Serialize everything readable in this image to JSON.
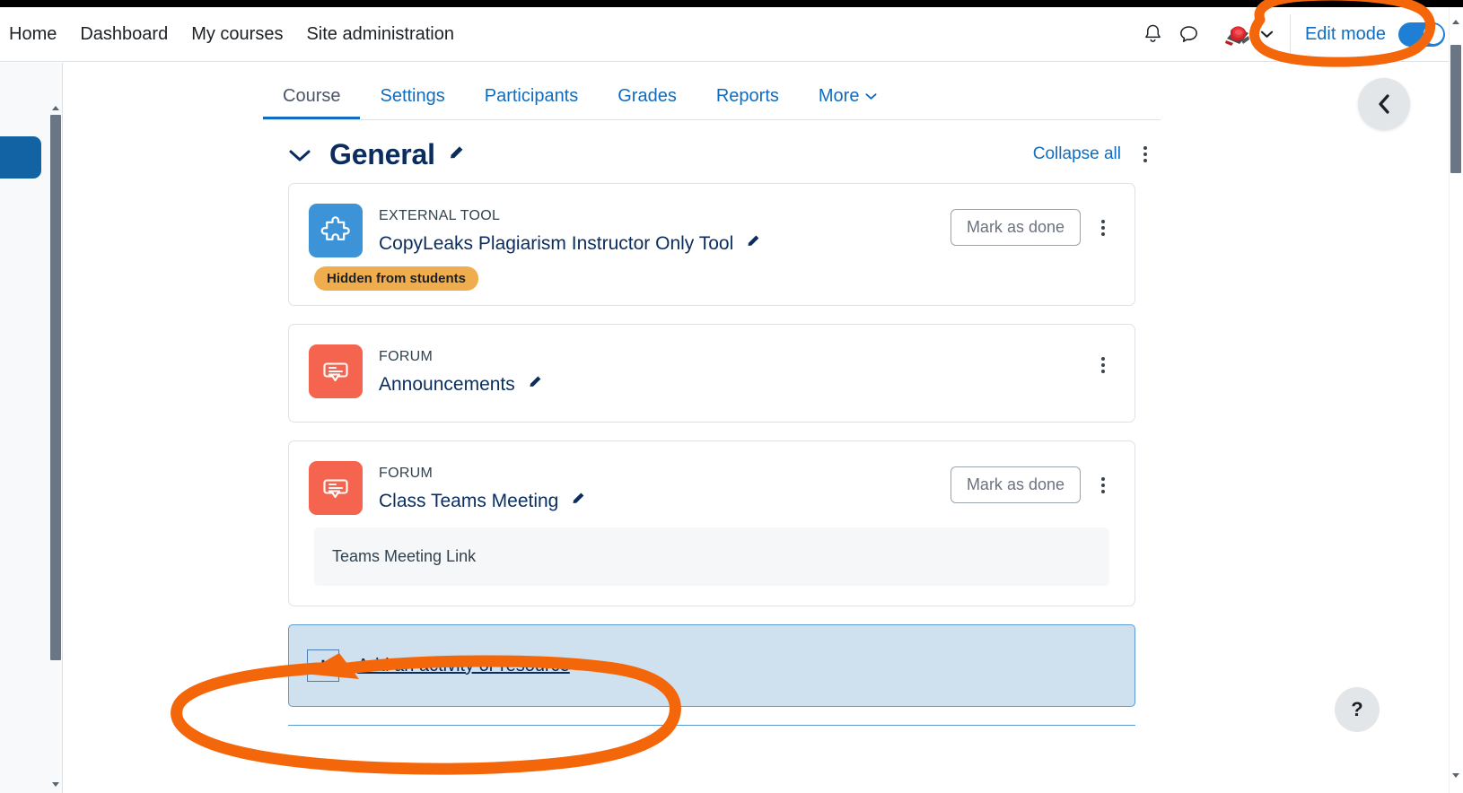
{
  "topnav": {
    "links": [
      {
        "label": "Home",
        "name": "nav-home"
      },
      {
        "label": "Dashboard",
        "name": "nav-dashboard"
      },
      {
        "label": "My courses",
        "name": "nav-my-courses"
      },
      {
        "label": "Site administration",
        "name": "nav-site-administration"
      }
    ],
    "notifications_icon": "bell-icon",
    "messages_icon": "speech-bubble-icon",
    "avatar_icon": "user-avatar",
    "caret_icon": "chevron-down-icon",
    "edit_mode_label": "Edit mode",
    "edit_mode_on": true
  },
  "course_tabs": [
    {
      "label": "Course",
      "active": true
    },
    {
      "label": "Settings",
      "active": false
    },
    {
      "label": "Participants",
      "active": false
    },
    {
      "label": "Grades",
      "active": false
    },
    {
      "label": "Reports",
      "active": false
    },
    {
      "label": "More",
      "active": false,
      "chevron": "⌄"
    }
  ],
  "section": {
    "title": "General",
    "collapse_toggle_icon": "chevron-down-icon",
    "edit_pencil_icon": "pencil-icon",
    "collapse_all_label": "Collapse all",
    "kebab_icon": "three-dot-menu-icon"
  },
  "activities": [
    {
      "kind": "EXTERNAL TOOL",
      "name": "CopyLeaks Plagiarism Instructor Only Tool",
      "icon": "puzzle-piece-icon",
      "icon_color": "#3d93d8",
      "icon_style": "blue",
      "badge": "Hidden from students",
      "mark_done_label": "Mark as done",
      "has_mark_done": true,
      "description": null
    },
    {
      "kind": "FORUM",
      "name": "Announcements",
      "icon": "forum-bubble-icon",
      "icon_color": "#f4644f",
      "icon_style": "coral",
      "badge": null,
      "mark_done_label": null,
      "has_mark_done": false,
      "description": null
    },
    {
      "kind": "FORUM",
      "name": "Class Teams Meeting",
      "icon": "forum-bubble-icon",
      "icon_color": "#f4644f",
      "icon_style": "coral",
      "badge": null,
      "mark_done_label": "Mark as done",
      "has_mark_done": true,
      "description": "Teams Meeting Link"
    }
  ],
  "add_activity": {
    "plus_label": "+",
    "link_label": "Add an activity or resource"
  },
  "floating": {
    "drawer_toggle_icon": "chevron-left-icon",
    "help_label": "?"
  },
  "annotations": {
    "edit_mode_circle_color": "#f4660a",
    "add_activity_circle_color": "#f4660a"
  }
}
